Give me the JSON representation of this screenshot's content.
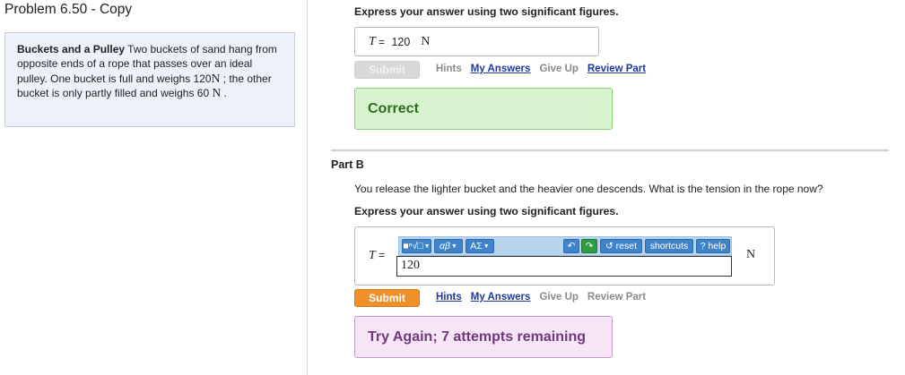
{
  "problem": {
    "title": "Problem 6.50 - Copy",
    "heading": "Buckets and a Pulley",
    "text_1": " Two buckets of sand hang from opposite ends of a rope that passes over an ideal pulley. One bucket is full and weighs 120",
    "unit_1": "N",
    "text_2": " ; the other bucket is only partly filled and weighs 60 ",
    "unit_2": "N",
    "text_3": " ."
  },
  "part_a": {
    "instruction": "Express your answer using two significant figures.",
    "answer": {
      "variable": "T",
      "equals": " = ",
      "value": "120",
      "unit": "N"
    },
    "submit_label": "Submit",
    "links": {
      "hints": "Hints",
      "my_answers": "My Answers",
      "give_up": "Give Up",
      "review_part": "Review Part"
    },
    "feedback": "Correct"
  },
  "part_b": {
    "label": "Part B",
    "question": "You release the lighter bucket and the heavier one descends. What is the tension in the rope now?",
    "instruction": "Express your answer using two significant figures.",
    "answer": {
      "variable": "T",
      "equals": " = ",
      "value": "120",
      "unit": "N"
    },
    "toolbar": {
      "templates": "■ⁿ√□",
      "greek": "αβ",
      "symbols": "ΑΣ",
      "undo": "↶",
      "redo": "↷",
      "reset": "↺ reset",
      "shortcuts": "shortcuts",
      "help": "? help"
    },
    "submit_label": "Submit",
    "links": {
      "hints": "Hints",
      "my_answers": "My Answers",
      "give_up": "Give Up",
      "review_part": "Review Part"
    },
    "feedback": "Try Again; 7 attempts remaining"
  },
  "colors": {
    "submit_active": "#f0902a",
    "correct_bg": "#d8f4cf",
    "try_again_bg": "#f6e4f7",
    "toolbar_bg": "#b9d5ee",
    "link_blue": "#1f3a9a"
  }
}
